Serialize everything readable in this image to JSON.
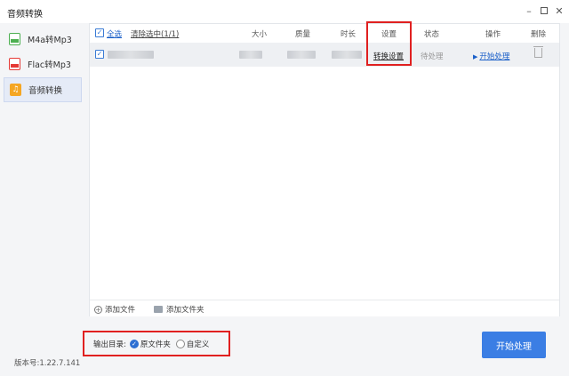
{
  "window": {
    "title": "音频转换",
    "minimize": "–",
    "close": "✕"
  },
  "sidebar": {
    "items": [
      {
        "label": "M4a转Mp3",
        "icon": "m4a-file-icon"
      },
      {
        "label": "Flac转Mp3",
        "icon": "flac-file-icon"
      },
      {
        "label": "音频转换",
        "icon": "music-note-icon",
        "active": true
      }
    ],
    "version": "版本号:1.22.7.141"
  },
  "table": {
    "select_all": "全选",
    "clear_selected": "清除选中(1/1)",
    "columns": {
      "size": "大小",
      "quality": "质量",
      "duration": "时长",
      "settings": "设置",
      "status": "状态",
      "action": "操作",
      "delete": "删除"
    },
    "rows": [
      {
        "checked": true,
        "settings": "转换设置",
        "status": "待处理",
        "action": "开始处理"
      }
    ]
  },
  "footer": {
    "add_file": "添加文件",
    "add_folder": "添加文件夹"
  },
  "output": {
    "label": "输出目录:",
    "option_original": "原文件夹",
    "option_custom": "自定义",
    "selected": "原文件夹"
  },
  "start_button": "开始处理",
  "colors": {
    "accent": "#3b7ee4",
    "highlight": "#e02020",
    "link": "#1a5fc8"
  }
}
